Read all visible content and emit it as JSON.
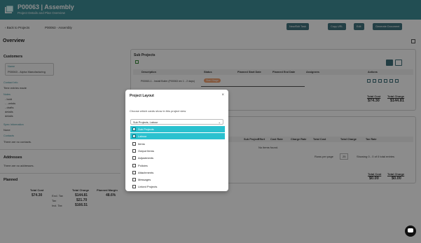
{
  "header": {
    "title": "P00063 | Assembly",
    "subtitle": "Project Details and Plan Overview"
  },
  "toolbar": {
    "back_label": "Back to Projects",
    "breadcrumb": "P00063 - Assembly",
    "buttons": [
      "New/Edit Task",
      "Copy URL",
      "Edit",
      "Generate Document"
    ]
  },
  "overview": {
    "title": "Overview"
  },
  "customers": {
    "heading": "Customers",
    "box_label": "Name",
    "box_value": "P00063 - Alpha Manufacturing",
    "contact_label": "Contact Info",
    "contact_value": "Time entries made",
    "notes_label": "Notes",
    "notes_lines": [
      "- bold",
      "- - wrists",
      "- drafts",
      "details",
      "details"
    ],
    "account_label": "Spec Information",
    "account_value": "None",
    "contacts_label": "Contacts",
    "contacts_value": "There are no contacts."
  },
  "addresses": {
    "heading": "Addresses",
    "value": "There are no addresses."
  },
  "planned": {
    "heading": "Planned",
    "total_cost_label": "Total Cost",
    "total_cost": "$74.30",
    "total_charge_label": "Total Charge",
    "planned_margin_label": "Planned Margin",
    "planned_margin": "48.6%",
    "rows": [
      {
        "label": "Excl. Tax",
        "value": "$144.81"
      },
      {
        "label": "Tax",
        "value": "$21.70"
      },
      {
        "label": "Incl. Tax",
        "value": "$166.51"
      }
    ]
  },
  "subprojects": {
    "heading": "Sub Projects",
    "columns": [
      "Description",
      "Status",
      "Planned Start Date",
      "Planned End Date",
      "Assignees",
      "Actions"
    ],
    "row": {
      "description": "P00063-1 - Install Boiler (P00063 rev 1 - 2 days)",
      "status": "Start Stage"
    },
    "total_cost_label": "Total Cost",
    "total_cost": "$74.30",
    "total_charge_label": "Total Charge",
    "total_charge": "$144.81"
  },
  "items": {
    "columns": [
      "Sub Project",
      "Effort",
      "Cost Rate",
      "Charge Rate",
      "Total Cost",
      "Total Charge",
      "Tax Rate"
    ],
    "empty": "No items found.",
    "rows_per_page_label": "Rows per page",
    "rows_per_page": "25",
    "showing": "Showing 0 - 0 of 0 total entries",
    "total_cost_label": "Total Cost",
    "total_cost": "$0.00",
    "total_charge_label": "Total Charge",
    "total_charge": "$0.00"
  },
  "modal": {
    "title": "Project Layout",
    "close": "×",
    "description": "Choose which cards show in this project view",
    "select_value": "Sub Projects, Labour",
    "options": [
      {
        "label": "Sub Projects",
        "checked": true
      },
      {
        "label": "Labour",
        "checked": true
      },
      {
        "label": "Items",
        "checked": false
      },
      {
        "label": "Output Items",
        "checked": false
      },
      {
        "label": "Adjustments",
        "checked": false
      },
      {
        "label": "Policies",
        "checked": false
      },
      {
        "label": "Attachments",
        "checked": false
      },
      {
        "label": "Messages",
        "checked": false
      },
      {
        "label": "Linked Projects",
        "checked": false
      }
    ]
  },
  "colors": {
    "header": "#3e8f98",
    "accent": "#2ac1cf",
    "button": "#41747f",
    "status": "#f0a070"
  }
}
